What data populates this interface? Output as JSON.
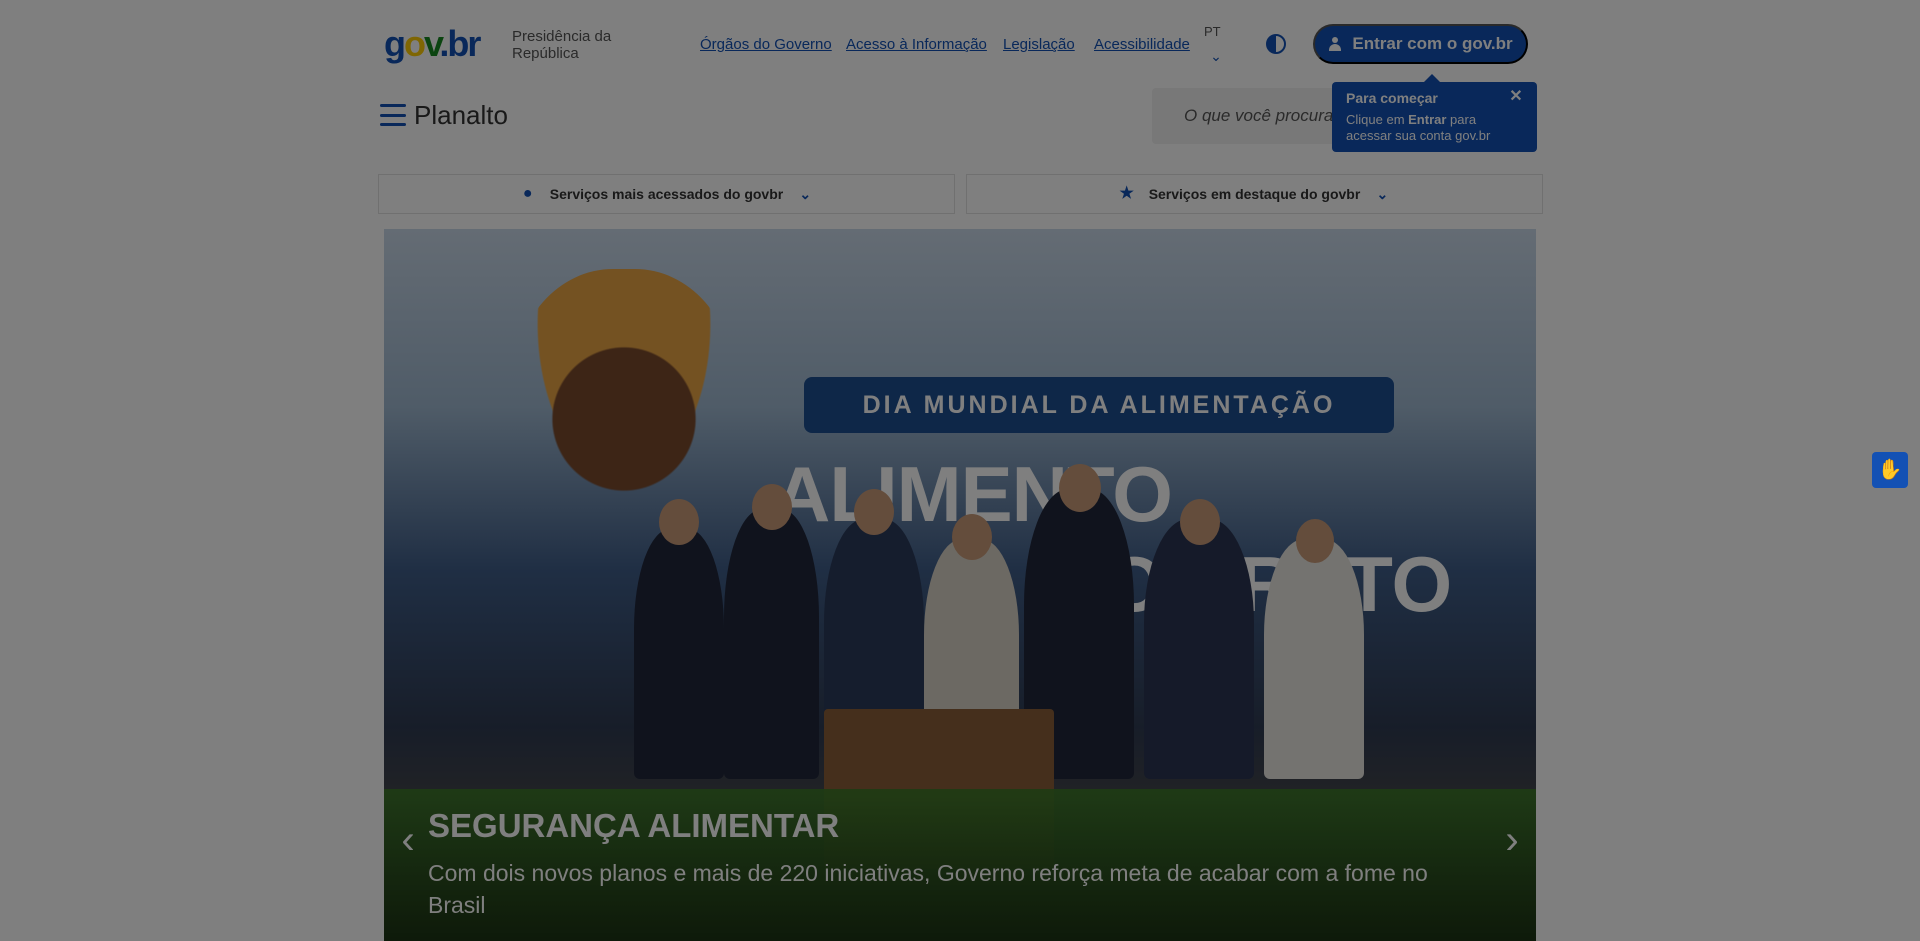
{
  "header": {
    "logo": {
      "g": "g",
      "o": "o",
      "v": "v",
      "dot": ".",
      "br": "br",
      "label": "Portal Gov.br"
    },
    "org": "Presidência da República",
    "links": [
      {
        "label": "Órgãos do Governo"
      },
      {
        "label": "Acesso à Informação"
      },
      {
        "label": "Legislação"
      },
      {
        "label": "Acessibilidade"
      }
    ],
    "lang": "PT",
    "login_label": "Entrar com o gov.br",
    "site_name": "Planalto",
    "search_placeholder": "O que você procura?",
    "tip": {
      "title": "Para começar",
      "text_pre": "Clique em ",
      "text_bold": "Entrar",
      "text_post": " para acessar sua conta gov.br",
      "close": "✕"
    }
  },
  "services": [
    {
      "label": "Serviços mais acessados do govbr",
      "icon": "flame-icon"
    },
    {
      "label": "Serviços em destaque do govbr",
      "icon": "star-icon"
    }
  ],
  "hero": {
    "banner": "DIA MUNDIAL DA ALIMENTAÇÃO",
    "big_line1": "ALIMENTO",
    "big_line2": "O PRATO",
    "caption_title": "SEGURANÇA ALIMENTAR",
    "caption_sub": "Com dois novos planos e mais de 220 iniciativas, Governo reforça meta de acabar com a fome no Brasil",
    "prev": "‹",
    "next": "›"
  },
  "colors": {
    "brand_blue": "#1351b4",
    "overlay": "rgba(0,0,0,0.5)"
  }
}
